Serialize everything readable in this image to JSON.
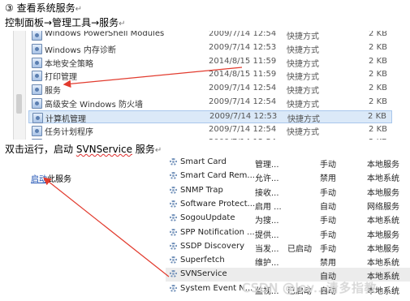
{
  "doc": {
    "step_title": "③ 查看系统服务",
    "nav_path_parts": [
      "控制面板",
      "管理工具",
      "服务"
    ],
    "nav_arrow": "→",
    "instruction_prefix": "双击运行，启动 ",
    "instruction_service": "SVNService",
    "instruction_suffix": " 服务",
    "return_mark": "↵"
  },
  "explorer": {
    "rows": [
      {
        "name": "Windows PowerShell Modules",
        "date": "2009/7/14 12:54",
        "type": "快捷方式",
        "size": "2 KB"
      },
      {
        "name": "Windows 内存诊断",
        "date": "2009/7/14 12:53",
        "type": "快捷方式",
        "size": "2 KB"
      },
      {
        "name": "本地安全策略",
        "date": "2014/8/15 11:59",
        "type": "快捷方式",
        "size": "2 KB"
      },
      {
        "name": "打印管理",
        "date": "2014/8/15 11:59",
        "type": "快捷方式",
        "size": "2 KB"
      },
      {
        "name": "服务",
        "date": "2009/7/14 12:54",
        "type": "快捷方式",
        "size": "2 KB"
      },
      {
        "name": "高级安全 Windows 防火墙",
        "date": "2009/7/14 12:54",
        "type": "快捷方式",
        "size": "2 KB"
      },
      {
        "name": "计算机管理",
        "date": "2009/7/14 12:53",
        "type": "快捷方式",
        "size": "2 KB"
      },
      {
        "name": "任务计划程序",
        "date": "2009/7/14 12:54",
        "type": "快捷方式",
        "size": "2 KB"
      },
      {
        "name": "事件查看器",
        "date": "2009/7/14 12:54",
        "type": "快捷方式",
        "size": "2 KB"
      }
    ],
    "selected_index": 6
  },
  "services": {
    "start_link": "启动",
    "start_link_suffix": "此服务",
    "rows": [
      {
        "name": "Smart Card",
        "desc": "管理...",
        "status": "",
        "startup": "手动",
        "logon": "本地服务"
      },
      {
        "name": "Smart Card Rem...",
        "desc": "允许...",
        "status": "",
        "startup": "禁用",
        "logon": "本地系统"
      },
      {
        "name": "SNMP Trap",
        "desc": "接收...",
        "status": "",
        "startup": "手动",
        "logon": "本地服务"
      },
      {
        "name": "Software Protect...",
        "desc": "启用 ...",
        "status": "",
        "startup": "自动",
        "logon": "网络服务"
      },
      {
        "name": "SogouUpdate",
        "desc": "为搜...",
        "status": "",
        "startup": "手动",
        "logon": "本地系统"
      },
      {
        "name": "SPP Notification ...",
        "desc": "提供...",
        "status": "",
        "startup": "手动",
        "logon": "本地服务"
      },
      {
        "name": "SSDP Discovery",
        "desc": "当发...",
        "status": "已启动",
        "startup": "手动",
        "logon": "本地服务"
      },
      {
        "name": "Superfetch",
        "desc": "维护...",
        "status": "",
        "startup": "禁用",
        "logon": "本地系统"
      },
      {
        "name": "SVNService",
        "desc": "",
        "status": "",
        "startup": "自动",
        "logon": "本地系统"
      },
      {
        "name": "System Event N...",
        "desc": "监视...",
        "status": "已启动",
        "startup": "自动",
        "logon": "本地系统"
      }
    ],
    "selected_index": 8
  },
  "watermark": "CSDN @lov...清多指教",
  "colors": {
    "arrow": "#e23b2e",
    "link": "#1a4fb3",
    "explorer_selection": "#dbe9f8"
  }
}
